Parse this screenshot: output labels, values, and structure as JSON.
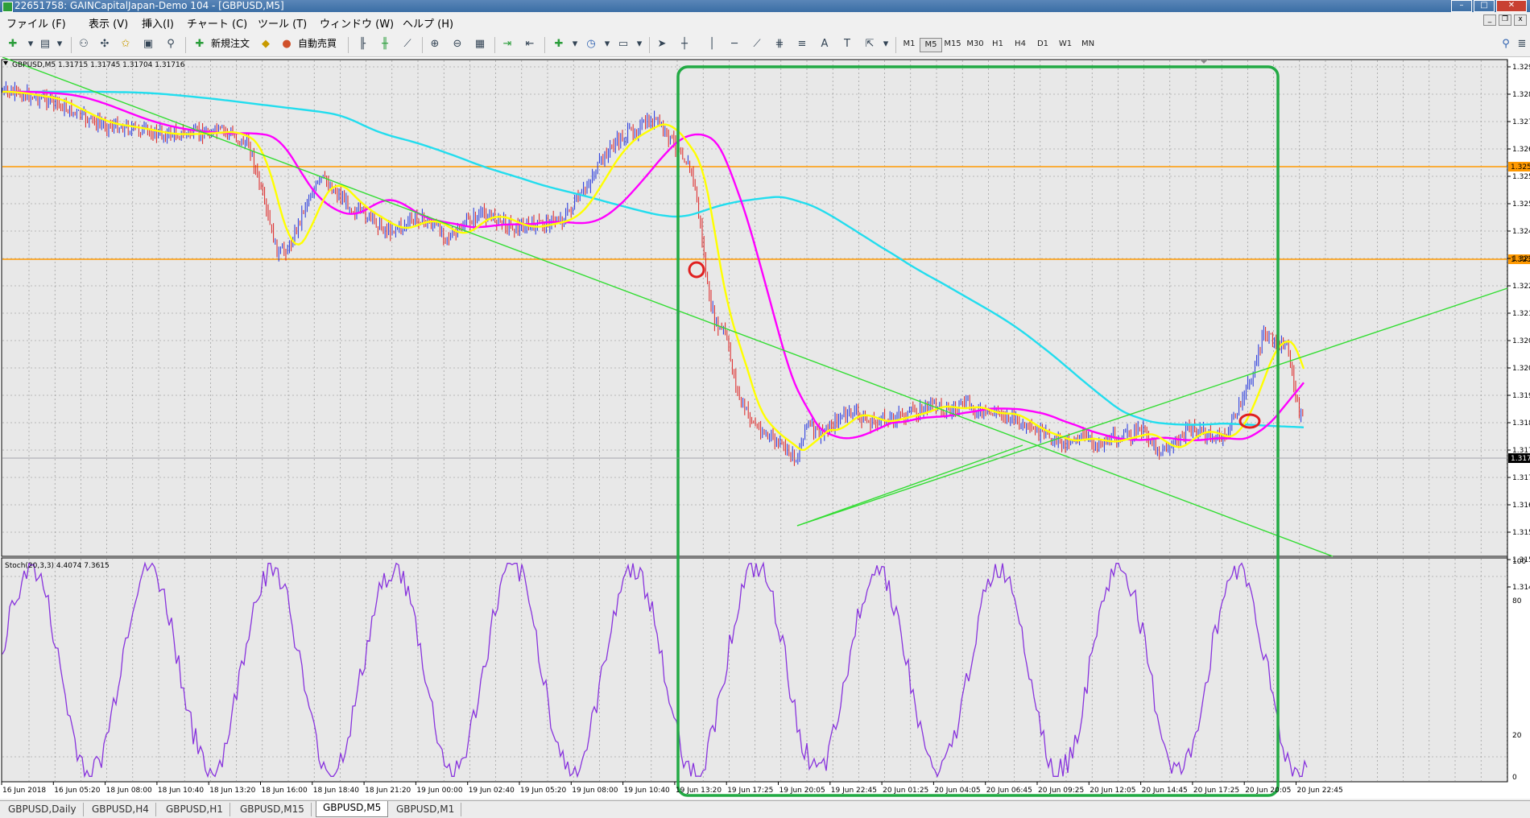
{
  "window": {
    "title": "22651758: GAINCapitalJapan-Demo 104 - [GBPUSD,M5]"
  },
  "menu": [
    "ファイル (F)",
    "表示 (V)",
    "挿入(I)",
    "チャート (C)",
    "ツール (T)",
    "ウィンドウ (W)",
    "ヘルプ (H)"
  ],
  "toolbar": {
    "new_order": "新規注文",
    "auto_trade": "自動売買",
    "timeframes": [
      "M1",
      "M5",
      "M15",
      "M30",
      "H1",
      "H4",
      "D1",
      "W1",
      "MN"
    ],
    "active_timeframe": "M5"
  },
  "chart": {
    "header": "GBPUSD,M5  1.31715 1.31745 1.31704 1.31716",
    "indicator_label": "Stoch(20,3,3) 4.4074 7.3615",
    "price_labels": [
      "1.329",
      "1.328",
      "1.327",
      "1.326",
      "1.325",
      "1.325",
      "1.324",
      "1.323",
      "1.322",
      "1.321",
      "1.320",
      "1.320",
      "1.319",
      "1.318",
      "1.317",
      "1.317",
      "1.316",
      "1.315",
      "1.315",
      "1.314"
    ],
    "current_price_tag": "1.317",
    "orange_tag_upper": "1.325",
    "orange_tag_lower": "1.323",
    "stoch_levels": [
      "100",
      "80",
      "20",
      "0"
    ],
    "time_labels": [
      "16 Jun 2018",
      "16 Jun 05:20",
      "18 Jun 08:00",
      "18 Jun 10:40",
      "18 Jun 13:20",
      "18 Jun 16:00",
      "18 Jun 18:40",
      "18 Jun 21:20",
      "19 Jun 00:00",
      "19 Jun 02:40",
      "19 Jun 05:20",
      "19 Jun 08:00",
      "19 Jun 10:40",
      "19 Jun 13:20",
      "19 Jun 17:25",
      "19 Jun 20:05",
      "19 Jun 22:45",
      "20 Jun 01:25",
      "20 Jun 04:05",
      "20 Jun 06:45",
      "20 Jun 09:25",
      "20 Jun 12:05",
      "20 Jun 14:45",
      "20 Jun 17:25",
      "20 Jun 20:05",
      "20 Jun 22:45"
    ],
    "colors": {
      "bull": "#2233dd",
      "bear": "#dd2222",
      "ma_fast": "#ffff00",
      "ma_mid": "#ff00ff",
      "ma_slow": "#22ddee",
      "hline": "#ff9900",
      "trend": "#33dd33",
      "box": "#22aa44",
      "stoch": "#8833dd"
    }
  },
  "tabs": [
    "GBPUSD,Daily",
    "GBPUSD,H4",
    "GBPUSD,H1",
    "GBPUSD,M15",
    "GBPUSD,M5",
    "GBPUSD,M1"
  ],
  "active_tab": "GBPUSD,M5"
}
